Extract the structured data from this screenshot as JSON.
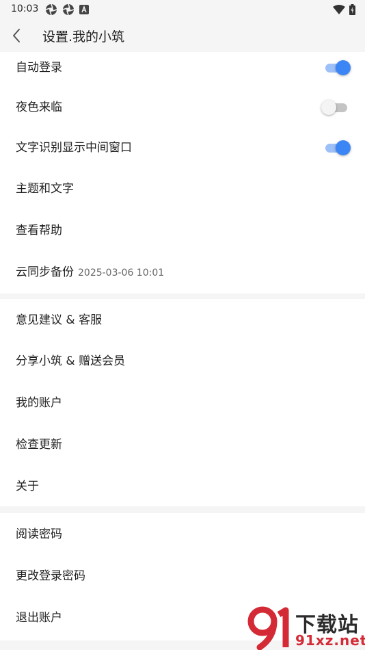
{
  "status": {
    "time": "10:03"
  },
  "header": {
    "title": "设置.我的小筑"
  },
  "group1": {
    "items": [
      {
        "label": "自动登录",
        "toggle": true
      },
      {
        "label": "夜色来临",
        "toggle": false
      },
      {
        "label": "文字识别显示中间窗口",
        "toggle": true
      },
      {
        "label": "主题和文字"
      },
      {
        "label": "查看帮助"
      },
      {
        "label": "云同步备份",
        "sub": "2025-03-06 10:01"
      }
    ]
  },
  "group2": {
    "items": [
      {
        "label": "意见建议 & 客服"
      },
      {
        "label": "分享小筑 & 赠送会员"
      },
      {
        "label": "我的账户"
      },
      {
        "label": "检查更新"
      },
      {
        "label": "关于"
      }
    ]
  },
  "group3": {
    "items": [
      {
        "label": "阅读密码"
      },
      {
        "label": "更改登录密码"
      },
      {
        "label": "退出账户"
      }
    ]
  },
  "watermark": {
    "text_cn": "下载站",
    "text_en": "91xz.net"
  },
  "colors": {
    "accent": "#3b85f5",
    "accent_track": "#9cc0f7",
    "background": "#f5f5f5"
  }
}
